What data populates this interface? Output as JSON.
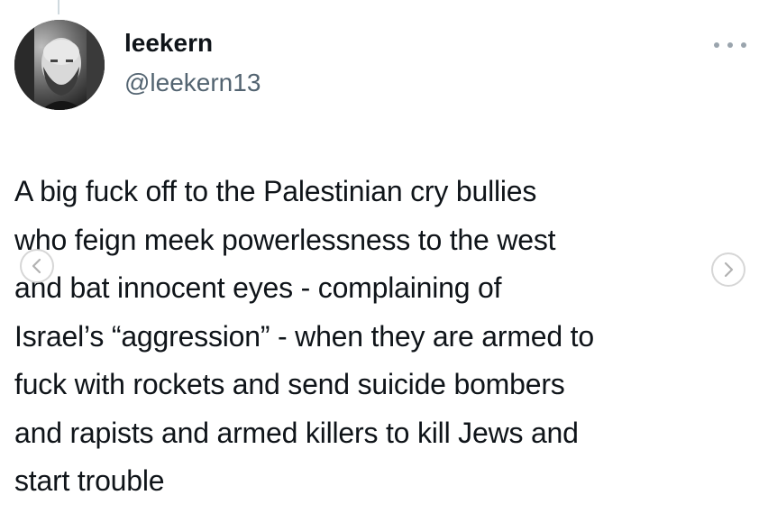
{
  "author": {
    "display_name": "leekern",
    "handle": "@leekern13"
  },
  "icons": {
    "more": "more-horizontal-icon",
    "prev": "chevron-left-icon",
    "next": "chevron-right-icon",
    "avatar": "avatar-photo"
  },
  "tweet": {
    "lines": [
      "A big fuck off to the Palestinian cry bullies",
      "who feign meek powerlessness to the west",
      "and bat innocent eyes - complaining of",
      "Israel’s “aggression” - when they are armed to",
      "fuck with rockets and send suicide bombers",
      "and rapists and armed killers to kill Jews and",
      "start trouble"
    ]
  },
  "colors": {
    "text_primary": "#0f1419",
    "text_secondary": "#536471",
    "background": "#ffffff"
  }
}
